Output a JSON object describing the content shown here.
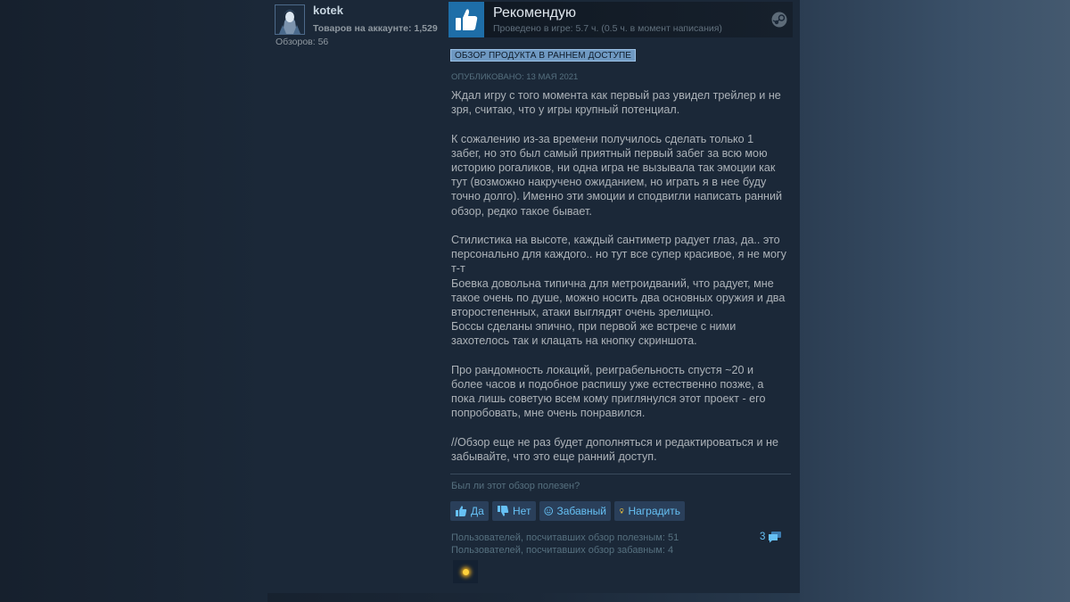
{
  "author": {
    "name": "kotek",
    "products_label": "Товаров на аккаунте: 1,529",
    "reviews_label": "Обзоров: 56"
  },
  "review": {
    "verdict": "Рекомендую",
    "hours": "Проведено в игре: 5.7 ч. (0.5 ч. в момент написания)",
    "early_access_badge": "ОБЗОР ПРОДУКТА В РАННЕМ ДОСТУПЕ",
    "posted": "ОПУБЛИКОВАНО: 13 МАЯ 2021",
    "paragraphs": [
      "Ждал игру с того момента как первый раз увидел трейлер и не\nзря, считаю, что у игры крупный потенциал.",
      "К сожалению из-за времени получилось сделать только 1\nзабег, но это был самый приятный первый забег за всю мою\nисторию рогаликов, ни одна игра не вызывала так эмоции как\nтут (возможно накручено ожиданием, но играть я в нее буду\nточно долго). Именно эти эмоции и сподвигли написать ранний\nобзор, редко такое бывает.",
      "Стилистика на высоте, каждый сантиметр радует глаз, да.. это\nперсонально для каждого.. но тут все супер красивое, я не могу\nт-т\nБоевка довольна типична для метроидваний, что радует, мне\nтакое очень по душе, можно носить два основных оружия и два\nвторостепенных, атаки выглядят очень зрелищно.\nБоссы сделаны эпично, при первой же встрече с ними\nзахотелось так и клацать на кнопку скриншота.",
      "Про рандомность локаций, реиграбельность спустя ~20 и\nболее часов и подобное распишу уже естественно позже, а\nпока лишь советую всем кому приглянулся этот проект - его\nпопробовать, мне очень понравился.",
      "//Обзор еще не раз будет дополняться и редактироваться и не\nзабывайте, что это еще ранний доступ."
    ]
  },
  "feedback": {
    "question": "Был ли этот обзор полезен?",
    "buttons": {
      "yes": "Да",
      "no": "Нет",
      "funny": "Забавный",
      "award": "Наградить"
    },
    "helpful_count": "Пользователей, посчитавших обзор полезным: 51",
    "funny_count": "Пользователей, посчитавших обзор забавным: 4",
    "comments_count": "3"
  },
  "icons": {
    "avatar": "avatar-image",
    "thumb": "thumbs-up-icon",
    "platform": "steam-icon",
    "yes": "thumbs-up-icon",
    "no": "thumbs-down-icon",
    "funny": "smiley-icon",
    "award": "award-icon",
    "comments": "comment-bubble-icon",
    "award_badge": "award-badge-icon"
  },
  "colors": {
    "accent_link": "#66c0f4",
    "thumb_bg": "#1e6ea8",
    "badge_bg": "#6f99c2",
    "page_bg": "#1b2838"
  }
}
